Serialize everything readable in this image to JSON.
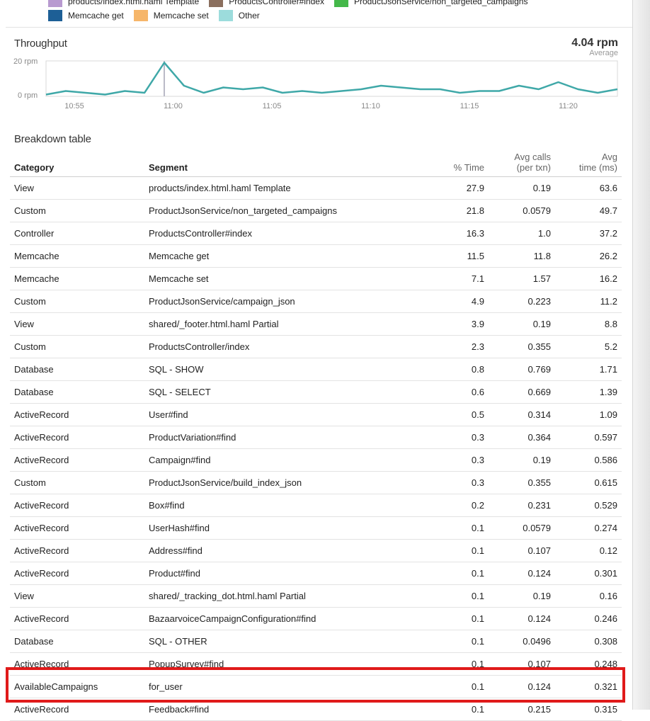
{
  "legend": {
    "row1": [
      {
        "label": "products/index.html.haml Template",
        "color": "#b89ad0"
      },
      {
        "label": "ProductsController#index",
        "color": "#8b6f5e"
      },
      {
        "label": "ProductJsonService/non_targeted_campaigns",
        "color": "#44b84a"
      }
    ],
    "row2": [
      {
        "label": "Memcache get",
        "color": "#1d5f96"
      },
      {
        "label": "Memcache set",
        "color": "#f6b66a"
      },
      {
        "label": "Other",
        "color": "#9cdcdc"
      }
    ]
  },
  "throughput": {
    "title": "Throughput",
    "average_value": "4.04 rpm",
    "average_label": "Average"
  },
  "chart_data": {
    "type": "line",
    "title": "Throughput",
    "ylim": [
      0,
      20
    ],
    "y_tick_labels": [
      "20 rpm",
      "0 rpm"
    ],
    "x_tick_labels": [
      "10:55",
      "11:00",
      "11:05",
      "11:10",
      "11:15",
      "11:20"
    ],
    "line_color": "#3fa8a8",
    "series": [
      {
        "values": [
          1,
          3,
          2,
          1,
          3,
          2,
          19,
          6,
          2,
          5,
          4,
          5,
          2,
          3,
          2,
          3,
          4,
          6,
          5,
          4,
          4,
          2,
          3,
          3,
          6,
          4,
          8,
          4,
          2,
          4
        ]
      }
    ]
  },
  "breakdown": {
    "title": "Breakdown table",
    "headers": {
      "category": "Category",
      "segment": "Segment",
      "time_pct": "% Time",
      "avg_calls_1": "Avg calls",
      "avg_calls_2": "(per txn)",
      "avg_time_1": "Avg",
      "avg_time_2": "time (ms)"
    },
    "rows": [
      {
        "category": "View",
        "segment": "products/index.html.haml Template",
        "pct": "27.9",
        "calls": "0.19",
        "time": "63.6"
      },
      {
        "category": "Custom",
        "segment": "ProductJsonService/non_targeted_campaigns",
        "pct": "21.8",
        "calls": "0.0579",
        "time": "49.7"
      },
      {
        "category": "Controller",
        "segment": "ProductsController#index",
        "pct": "16.3",
        "calls": "1.0",
        "time": "37.2"
      },
      {
        "category": "Memcache",
        "segment": "Memcache get",
        "pct": "11.5",
        "calls": "11.8",
        "time": "26.2"
      },
      {
        "category": "Memcache",
        "segment": "Memcache set",
        "pct": "7.1",
        "calls": "1.57",
        "time": "16.2"
      },
      {
        "category": "Custom",
        "segment": "ProductJsonService/campaign_json",
        "pct": "4.9",
        "calls": "0.223",
        "time": "11.2"
      },
      {
        "category": "View",
        "segment": "shared/_footer.html.haml Partial",
        "pct": "3.9",
        "calls": "0.19",
        "time": "8.8"
      },
      {
        "category": "Custom",
        "segment": "ProductsController/index",
        "pct": "2.3",
        "calls": "0.355",
        "time": "5.2"
      },
      {
        "category": "Database",
        "segment": "SQL - SHOW",
        "pct": "0.8",
        "calls": "0.769",
        "time": "1.71"
      },
      {
        "category": "Database",
        "segment": "SQL - SELECT",
        "pct": "0.6",
        "calls": "0.669",
        "time": "1.39"
      },
      {
        "category": "ActiveRecord",
        "segment": "User#find",
        "pct": "0.5",
        "calls": "0.314",
        "time": "1.09"
      },
      {
        "category": "ActiveRecord",
        "segment": "ProductVariation#find",
        "pct": "0.3",
        "calls": "0.364",
        "time": "0.597"
      },
      {
        "category": "ActiveRecord",
        "segment": "Campaign#find",
        "pct": "0.3",
        "calls": "0.19",
        "time": "0.586"
      },
      {
        "category": "Custom",
        "segment": "ProductJsonService/build_index_json",
        "pct": "0.3",
        "calls": "0.355",
        "time": "0.615"
      },
      {
        "category": "ActiveRecord",
        "segment": "Box#find",
        "pct": "0.2",
        "calls": "0.231",
        "time": "0.529"
      },
      {
        "category": "ActiveRecord",
        "segment": "UserHash#find",
        "pct": "0.1",
        "calls": "0.0579",
        "time": "0.274"
      },
      {
        "category": "ActiveRecord",
        "segment": "Address#find",
        "pct": "0.1",
        "calls": "0.107",
        "time": "0.12"
      },
      {
        "category": "ActiveRecord",
        "segment": "Product#find",
        "pct": "0.1",
        "calls": "0.124",
        "time": "0.301"
      },
      {
        "category": "View",
        "segment": "shared/_tracking_dot.html.haml Partial",
        "pct": "0.1",
        "calls": "0.19",
        "time": "0.16"
      },
      {
        "category": "ActiveRecord",
        "segment": "BazaarvoiceCampaignConfiguration#find",
        "pct": "0.1",
        "calls": "0.124",
        "time": "0.246"
      },
      {
        "category": "Database",
        "segment": "SQL - OTHER",
        "pct": "0.1",
        "calls": "0.0496",
        "time": "0.308"
      },
      {
        "category": "ActiveRecord",
        "segment": "PopupSurvey#find",
        "pct": "0.1",
        "calls": "0.107",
        "time": "0.248"
      },
      {
        "category": "AvailableCampaigns",
        "segment": "for_user",
        "pct": "0.1",
        "calls": "0.124",
        "time": "0.321"
      },
      {
        "category": "ActiveRecord",
        "segment": "Feedback#find",
        "pct": "0.1",
        "calls": "0.215",
        "time": "0.315"
      }
    ]
  },
  "highlight_color": "#e01a1a"
}
